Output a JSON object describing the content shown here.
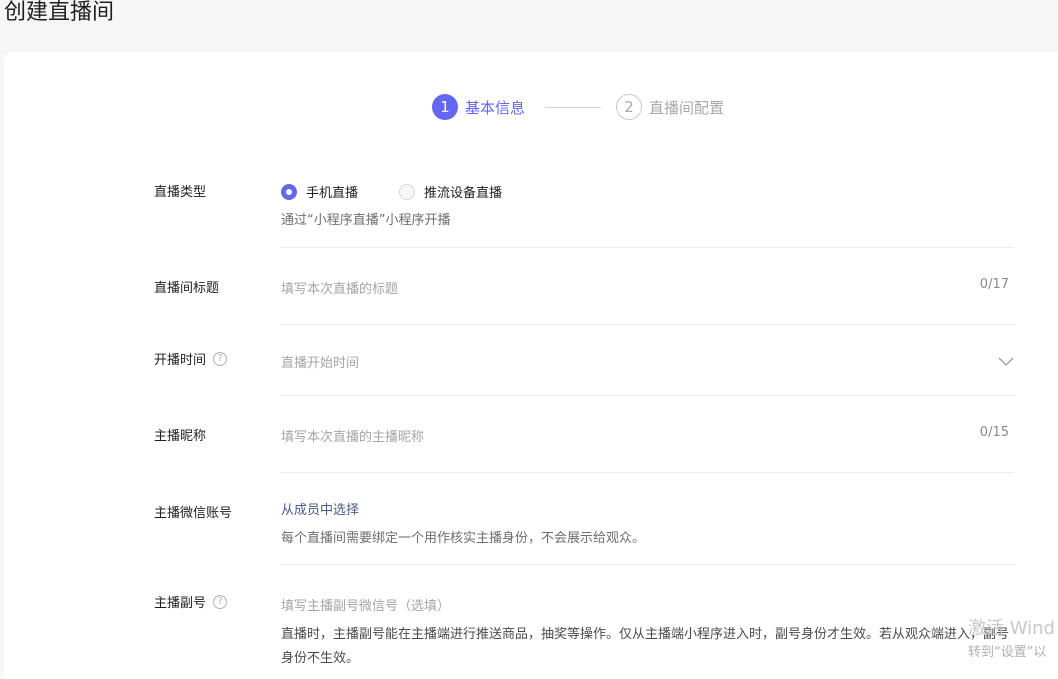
{
  "page": {
    "title": "创建直播间"
  },
  "steps": [
    {
      "num": "1",
      "label": "基本信息"
    },
    {
      "num": "2",
      "label": "直播间配置"
    }
  ],
  "form": {
    "live_type": {
      "label": "直播类型",
      "options": [
        "手机直播",
        "推流设备直播"
      ],
      "selected": "手机直播",
      "hint": "通过“小程序直播”小程序开播"
    },
    "room_title": {
      "label": "直播间标题",
      "placeholder": "填写本次直播的标题",
      "counter": "0/17"
    },
    "start_time": {
      "label": "开播时间",
      "placeholder": "直播开始时间"
    },
    "anchor_nickname": {
      "label": "主播昵称",
      "placeholder": "填写本次直播的主播昵称",
      "counter": "0/15"
    },
    "anchor_wechat": {
      "label": "主播微信账号",
      "link": "从成员中选择",
      "hint": "每个直播间需要绑定一个用作核实主播身份，不会展示给观众。"
    },
    "sub_anchor": {
      "label": "主播副号",
      "placeholder": "填写主播副号微信号（选填）",
      "hint": "直播时，主播副号能在主播端进行推送商品，抽奖等操作。仅从主播端小程序进入时，副号身份才生效。若从观众端进入，副号身份不生效。"
    }
  },
  "icons": {
    "help": "question-circle-icon",
    "chevron": "chevron-down-icon"
  },
  "watermark": {
    "line1": "激活 Wind",
    "line2": "转到“设置”以"
  },
  "colors": {
    "accent": "#6467f0",
    "link": "#4a5b84"
  }
}
